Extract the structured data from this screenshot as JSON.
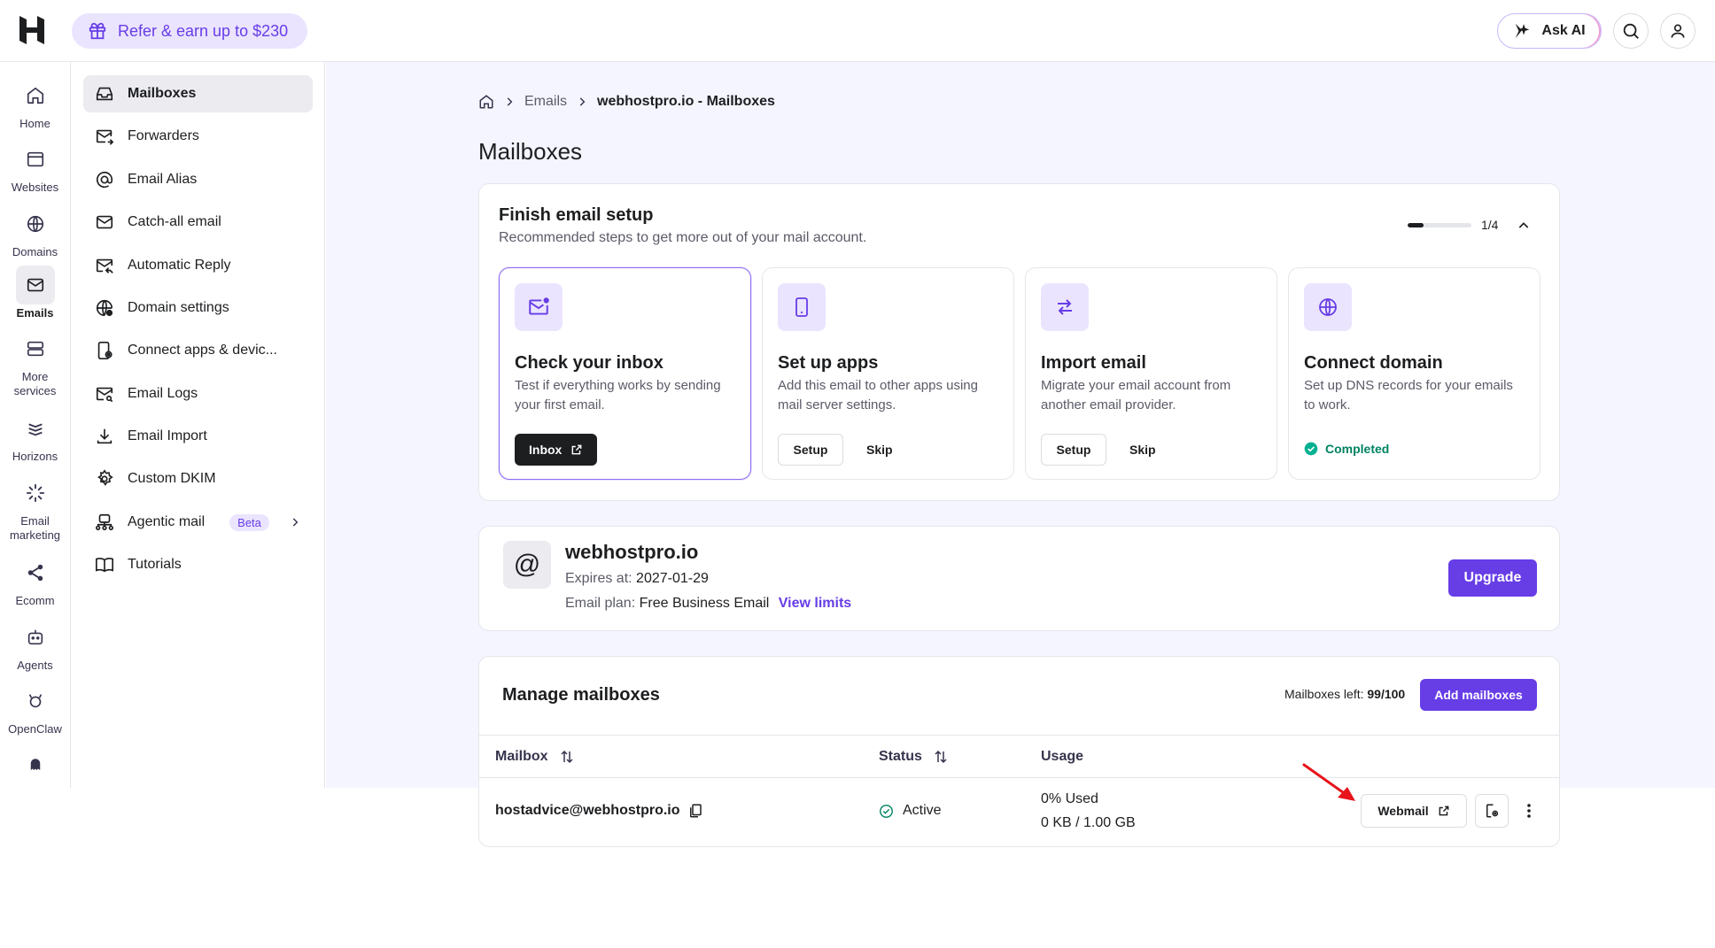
{
  "topbar": {
    "refer_label": "Refer & earn up to $230",
    "ask_ai_label": "Ask AI",
    "icons": [
      "hostinger-logo",
      "gift-icon",
      "sparkle-icon",
      "search-icon",
      "user-icon"
    ]
  },
  "rail": {
    "items": [
      {
        "label": "Home",
        "icon": "home-icon"
      },
      {
        "label": "Websites",
        "icon": "browser-icon"
      },
      {
        "label": "Domains",
        "icon": "globe-icon"
      },
      {
        "label": "Emails",
        "icon": "envelope-icon",
        "active": true
      },
      {
        "label": "More services",
        "icon": "server-icon"
      },
      {
        "label": "Horizons",
        "icon": "horizons-icon"
      },
      {
        "label": "Email marketing",
        "icon": "loader-icon"
      },
      {
        "label": "Ecomm",
        "icon": "share-icon"
      },
      {
        "label": "Agents",
        "icon": "bot-icon"
      },
      {
        "label": "OpenClaw",
        "icon": "claw-icon"
      }
    ]
  },
  "subnav": {
    "items": [
      {
        "label": "Mailboxes",
        "icon": "inbox-icon",
        "active": true
      },
      {
        "label": "Forwarders",
        "icon": "forward-mail-icon"
      },
      {
        "label": "Email Alias",
        "icon": "at-icon"
      },
      {
        "label": "Catch-all email",
        "icon": "envelope-icon"
      },
      {
        "label": "Automatic Reply",
        "icon": "reply-mail-icon"
      },
      {
        "label": "Domain settings",
        "icon": "globe-gear-icon"
      },
      {
        "label": "Connect apps & devic...",
        "icon": "device-gear-icon"
      },
      {
        "label": "Email Logs",
        "icon": "mail-search-icon"
      },
      {
        "label": "Email Import",
        "icon": "download-icon"
      },
      {
        "label": "Custom DKIM",
        "icon": "gear-icon"
      },
      {
        "label": "Agentic mail",
        "icon": "agent-mail-icon",
        "badge": "Beta"
      },
      {
        "label": "Tutorials",
        "icon": "book-icon"
      }
    ]
  },
  "breadcrumb": {
    "parent": "Emails",
    "current": "webhostpro.io - Mailboxes"
  },
  "page_title": "Mailboxes",
  "setup": {
    "title": "Finish email setup",
    "subtitle": "Recommended steps to get more out of your mail account.",
    "progress_text": "1/4",
    "progress_fraction": 0.25,
    "steps": [
      {
        "title": "Check your inbox",
        "desc": "Test if everything works by sending your first email.",
        "button": "Inbox",
        "icon": "mail-dot-icon"
      },
      {
        "title": "Set up apps",
        "desc": "Add this email to other apps using mail server settings.",
        "button": "Setup",
        "skip": "Skip",
        "icon": "phone-icon"
      },
      {
        "title": "Import email",
        "desc": "Migrate your email account from another email provider.",
        "button": "Setup",
        "skip": "Skip",
        "icon": "arrows-swap-icon"
      },
      {
        "title": "Connect domain",
        "desc": "Set up DNS records for your emails to work.",
        "status": "Completed",
        "icon": "globe-icon"
      }
    ]
  },
  "domain": {
    "name": "webhostpro.io",
    "expires_label": "Expires at:",
    "expires_value": "2027-01-29",
    "plan_label": "Email plan:",
    "plan_value": "Free Business Email",
    "view_limits": "View limits",
    "upgrade": "Upgrade",
    "at_symbol": "@"
  },
  "manage": {
    "title": "Manage mailboxes",
    "left_label": "Mailboxes left:",
    "left_value": "99/100",
    "add_button": "Add mailboxes",
    "columns": [
      "Mailbox",
      "Status",
      "Usage"
    ],
    "rows": [
      {
        "mailbox": "hostadvice@webhostpro.io",
        "status": "Active",
        "usage_pct": "0% Used",
        "usage_amount": "0 KB / 1.00 GB",
        "webmail": "Webmail"
      }
    ]
  },
  "colors": {
    "accent": "#673de6",
    "success": "#008361",
    "annotation_arrow": "#e8141b"
  }
}
